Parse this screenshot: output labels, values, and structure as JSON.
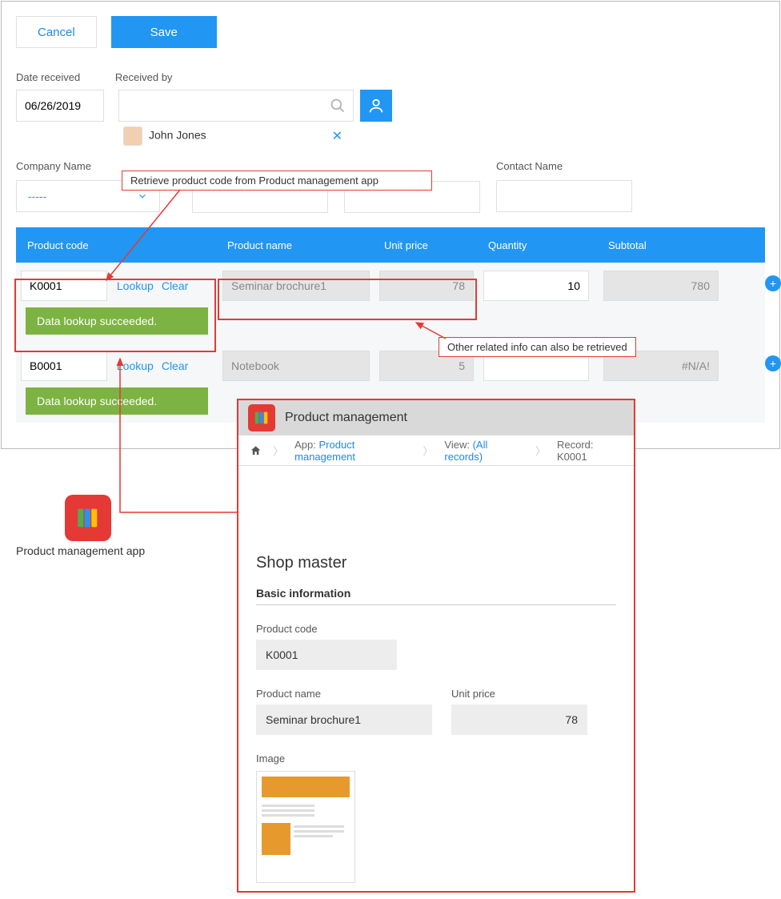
{
  "buttons": {
    "cancel": "Cancel",
    "save": "Save"
  },
  "labels": {
    "date_received": "Date received",
    "received_by": "Received by",
    "company_name": "Company Name",
    "contact_name": "Contact Name"
  },
  "date_received": "06/26/2019",
  "received_by_user": "John Jones",
  "company_select_placeholder": "-----",
  "table": {
    "headers": {
      "code": "Product code",
      "name": "Product name",
      "price": "Unit price",
      "qty": "Quantity",
      "subtotal": "Subtotal"
    },
    "lookup_label": "Lookup",
    "clear_label": "Clear",
    "success_msg": "Data lookup succeeded.",
    "rows": [
      {
        "code": "K0001",
        "name": "Seminar brochure1",
        "price": "78",
        "qty": "10",
        "subtotal": "780"
      },
      {
        "code": "B0001",
        "name": "Notebook",
        "price": "5",
        "qty": "",
        "subtotal": "#N/A!"
      }
    ]
  },
  "annotations": {
    "a1": "Retrieve product code from Product management app",
    "a2": "Other related info can also be retrieved"
  },
  "pm_app_label": "Product management app",
  "pm_panel": {
    "title": "Product management",
    "crumb_app_prefix": "App: ",
    "crumb_app": "Product management",
    "crumb_view_prefix": "View: ",
    "crumb_view": "(All records)",
    "crumb_record": "Record: K0001",
    "section_title": "Shop master",
    "subsection": "Basic information",
    "pc_label": "Product code",
    "pc_value": "K0001",
    "pn_label": "Product name",
    "pn_value": "Seminar brochure1",
    "up_label": "Unit price",
    "up_value": "78",
    "img_label": "Image"
  }
}
